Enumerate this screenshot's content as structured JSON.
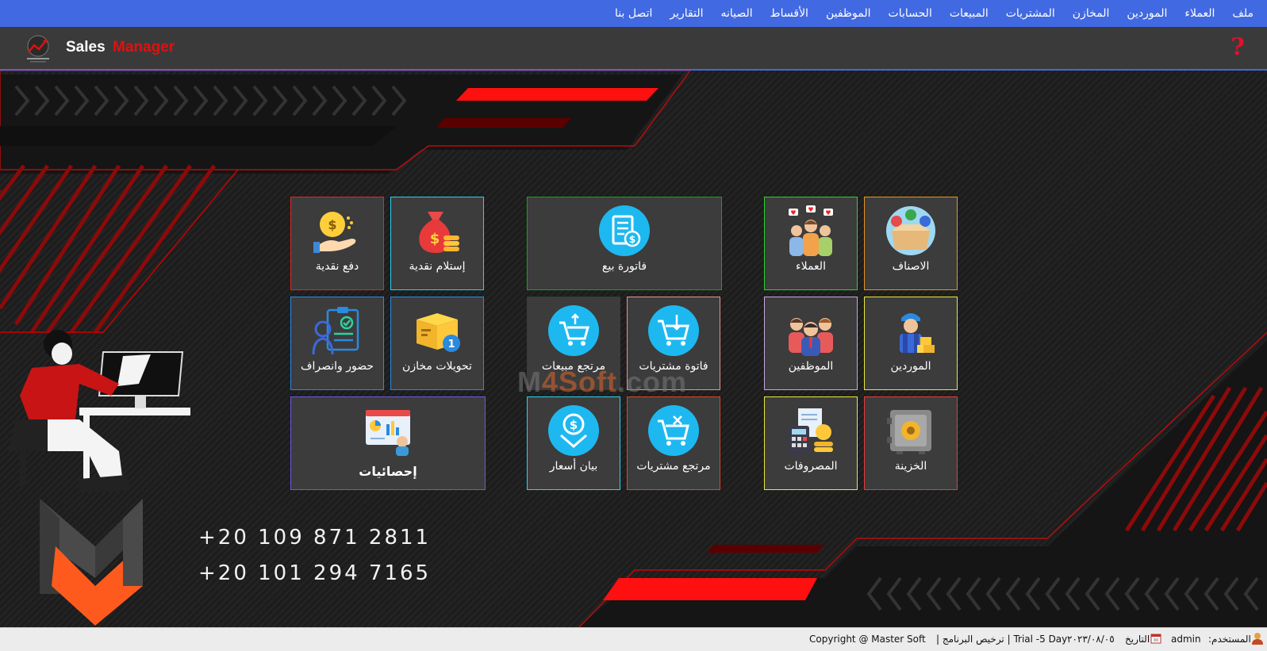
{
  "menu": {
    "items": [
      "ملف",
      "العملاء",
      "الموردين",
      "المخازن",
      "المشتريات",
      "المبيعات",
      "الحسابات",
      "الموظفين",
      "الأقساط",
      "الصيانه",
      "التقارير",
      "اتصل بنا"
    ]
  },
  "header": {
    "title_part1": "Sales",
    "title_part2": "Manager",
    "help_glyph": "?"
  },
  "tiles": {
    "cash_payment": "دفع نقدية",
    "cash_receipt": "إستلام نقدية",
    "sales_invoice": "فاتورة بيع",
    "customers": "العملاء",
    "items": "الاصناف",
    "attendance": "حضور وانصراف",
    "store_transfers": "تحويلات مخازن",
    "sales_return": "مرتجع مبيعات",
    "purchase_invoice": "فاتوة مشتريات",
    "employees": "الموظفين",
    "suppliers": "الموردين",
    "statistics": "إحصائيات",
    "price_quote": "بيان أسعار",
    "purchase_return": "مرتجع مشتريات",
    "expenses": "المصروفات",
    "treasury": "الخزينة"
  },
  "watermark": {
    "part1": "M",
    "part2": "4Soft",
    "part3": ".com"
  },
  "contact": {
    "phone1": "+20 109 871 2811",
    "phone2": "+20 101 294 7165"
  },
  "status": {
    "user_label": "المستخدم:",
    "user_value": "admin",
    "date_label": "التاريخ",
    "date_value": "٢٠٢٣/٠٨/٠٥",
    "license": "Trial -5 Day  | ترخيص البرنامج |",
    "copyright": "Copyright @ Master Soft"
  },
  "colors": {
    "menu_bg": "#4169e1",
    "accent_red": "#e01010",
    "tile_bg": "#3c3c3c"
  }
}
